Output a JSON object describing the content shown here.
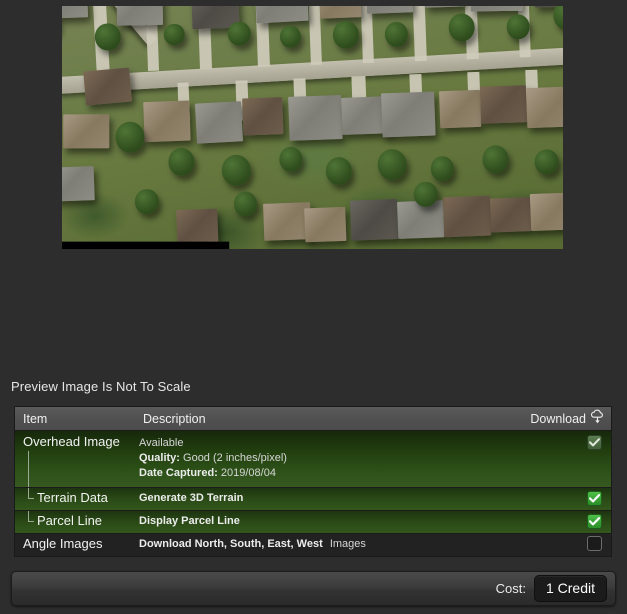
{
  "preview": {
    "alt_description": "Aerial overhead image of a suburban residential neighborhood with houses, lawns, trees and a street running horizontally",
    "caption": "Preview Image Is Not To Scale"
  },
  "table": {
    "columns": {
      "item": "Item",
      "description": "Description",
      "download": "Download",
      "download_icon": "cloud-download-icon"
    },
    "rows": [
      {
        "item": "Overhead Image",
        "description_lines": [
          {
            "label": "",
            "value": "Available"
          },
          {
            "label": "Quality:",
            "value": "Good (2 inches/pixel)"
          },
          {
            "label": "Date Captured:",
            "value": "2019/08/04"
          }
        ],
        "checked": true,
        "checkbox_state": "checked-muted",
        "level": 0,
        "row_style": "green"
      },
      {
        "item": "Terrain Data",
        "description_lines": [
          {
            "label": "Generate 3D Terrain",
            "value": ""
          }
        ],
        "checked": true,
        "checkbox_state": "checked",
        "level": 1,
        "row_style": "green-sm"
      },
      {
        "item": "Parcel Line",
        "description_lines": [
          {
            "label": "Display Parcel Line",
            "value": ""
          }
        ],
        "checked": true,
        "checkbox_state": "checked",
        "level": 1,
        "row_style": "green-sm"
      },
      {
        "item": "Angle Images",
        "description_lines": [
          {
            "label": "Download North, South, East, West",
            "value": "Images"
          }
        ],
        "checked": false,
        "checkbox_state": "empty",
        "level": 0,
        "row_style": "dark"
      }
    ]
  },
  "footer": {
    "cost_label": "Cost:",
    "cost_value": "1 Credit"
  },
  "colors": {
    "page_background": "#2d2d2d",
    "header_background": "#545454",
    "row_green_top": "#16280c",
    "row_green_bottom": "#35591f",
    "row_dark": "#222222",
    "checkbox_green": "#3aa634",
    "checkbox_muted": "#4b6b42",
    "text": "#e8e8e8"
  }
}
